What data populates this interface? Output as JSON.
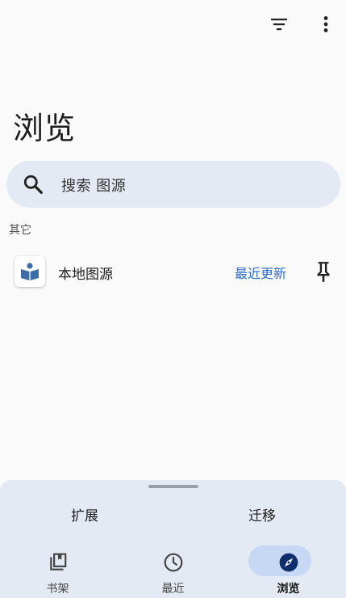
{
  "header": {
    "title": "浏览",
    "filter_icon": "filter-icon",
    "more_icon": "more-vert-icon"
  },
  "search": {
    "placeholder": "搜索 图源",
    "icon": "search-icon"
  },
  "sections": [
    {
      "header": "其它",
      "sources": [
        {
          "name": "本地图源",
          "latest_label": "最近更新",
          "icon": "book-icon",
          "pin_icon": "pin-icon"
        }
      ]
    }
  ],
  "bottom_sheet": {
    "tabs": [
      {
        "label": "扩展"
      },
      {
        "label": "迁移"
      }
    ]
  },
  "bottom_nav": {
    "items": [
      {
        "label": "书架",
        "icon": "bookshelf-icon",
        "active": false
      },
      {
        "label": "最近",
        "icon": "clock-icon",
        "active": false
      },
      {
        "label": "浏览",
        "icon": "compass-icon",
        "active": true
      }
    ]
  },
  "colors": {
    "background": "#fafafa",
    "surface": "#e4eaf4",
    "accent": "#2f6fc4",
    "active_pill": "#c6d8f4",
    "active_icon": "#0f2f6b"
  }
}
